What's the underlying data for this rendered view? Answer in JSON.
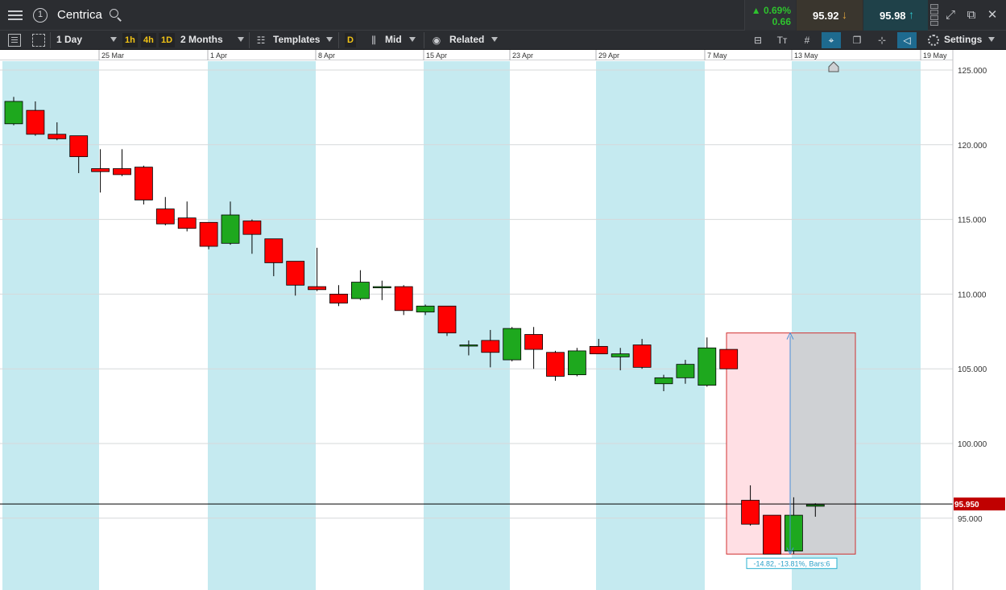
{
  "header": {
    "instrument": "Centrica",
    "change_pct": "0.69%",
    "change_abs": "0.66",
    "sell_price": "95.92",
    "buy_price": "95.98"
  },
  "toolbar": {
    "interval": "1 Day",
    "quick_intervals": [
      "1h",
      "4h",
      "1D"
    ],
    "range": "2 Months",
    "templates": "Templates",
    "d_chip": "D",
    "price_type": "Mid",
    "related": "Related",
    "settings": "Settings",
    "active_tools": [
      "crosshair-tool",
      "label-tool"
    ]
  },
  "colors": {
    "up": "#1ea81e",
    "down": "#ff0000",
    "weekend_band": "#c5eaf0",
    "price_marker": "#c00000",
    "range_box_red": "#ffdfe4",
    "range_box_grey": "#cfd1d4"
  },
  "chart_data": {
    "type": "candlestick",
    "title": "",
    "x_tick_labels": [
      "25 Mar",
      "1 Apr",
      "8 Apr",
      "15 Apr",
      "23 Apr",
      "29 Apr",
      "7 May",
      "13 May",
      "19 May"
    ],
    "y_ticks": [
      95,
      100,
      105,
      110,
      115,
      120,
      125
    ],
    "y_tick_labels": [
      "95.000",
      "100.000",
      "105.000",
      "110.000",
      "115.000",
      "120.000",
      "125.000"
    ],
    "ylim": [
      90.8,
      125.5
    ],
    "grid": true,
    "current_price": 95.95,
    "current_price_label": "95.950",
    "candles": [
      {
        "o": 121.4,
        "h": 123.2,
        "l": 121.3,
        "c": 122.9
      },
      {
        "o": 122.3,
        "h": 122.9,
        "l": 120.6,
        "c": 120.7
      },
      {
        "o": 120.7,
        "h": 121.5,
        "l": 120.3,
        "c": 120.4
      },
      {
        "o": 120.6,
        "h": 120.6,
        "l": 118.1,
        "c": 119.2
      },
      {
        "o": 118.4,
        "h": 119.7,
        "l": 116.8,
        "c": 118.2
      },
      {
        "o": 118.4,
        "h": 119.7,
        "l": 117.9,
        "c": 118.0
      },
      {
        "o": 118.5,
        "h": 118.6,
        "l": 116.0,
        "c": 116.3
      },
      {
        "o": 115.7,
        "h": 116.5,
        "l": 114.6,
        "c": 114.7
      },
      {
        "o": 115.1,
        "h": 116.2,
        "l": 114.2,
        "c": 114.4
      },
      {
        "o": 114.8,
        "h": 114.8,
        "l": 113.0,
        "c": 113.2
      },
      {
        "o": 113.4,
        "h": 116.2,
        "l": 113.3,
        "c": 115.3
      },
      {
        "o": 114.9,
        "h": 115.0,
        "l": 112.7,
        "c": 114.0
      },
      {
        "o": 113.7,
        "h": 113.7,
        "l": 111.2,
        "c": 112.1
      },
      {
        "o": 112.2,
        "h": 112.2,
        "l": 109.9,
        "c": 110.6
      },
      {
        "o": 110.5,
        "h": 113.1,
        "l": 110.2,
        "c": 110.3
      },
      {
        "o": 110.0,
        "h": 110.6,
        "l": 109.2,
        "c": 109.4
      },
      {
        "o": 109.7,
        "h": 111.6,
        "l": 109.6,
        "c": 110.8
      },
      {
        "o": 110.5,
        "h": 110.9,
        "l": 109.6,
        "c": 110.5
      },
      {
        "o": 110.5,
        "h": 110.6,
        "l": 108.6,
        "c": 108.9
      },
      {
        "o": 108.8,
        "h": 109.3,
        "l": 108.6,
        "c": 109.2
      },
      {
        "o": 109.2,
        "h": 109.2,
        "l": 107.2,
        "c": 107.4
      },
      {
        "o": 106.6,
        "h": 106.9,
        "l": 105.9,
        "c": 106.6
      },
      {
        "o": 106.9,
        "h": 107.6,
        "l": 105.1,
        "c": 106.1
      },
      {
        "o": 105.6,
        "h": 107.8,
        "l": 105.5,
        "c": 107.7
      },
      {
        "o": 107.3,
        "h": 107.8,
        "l": 105.0,
        "c": 106.3
      },
      {
        "o": 106.1,
        "h": 106.2,
        "l": 104.2,
        "c": 104.5
      },
      {
        "o": 104.6,
        "h": 106.4,
        "l": 104.5,
        "c": 106.2
      },
      {
        "o": 106.5,
        "h": 107.0,
        "l": 106.0,
        "c": 106.0
      },
      {
        "o": 105.8,
        "h": 106.4,
        "l": 104.9,
        "c": 106.0
      },
      {
        "o": 106.6,
        "h": 107.0,
        "l": 105.0,
        "c": 105.1
      },
      {
        "o": 104.0,
        "h": 104.6,
        "l": 103.5,
        "c": 104.4
      },
      {
        "o": 104.4,
        "h": 105.6,
        "l": 104.0,
        "c": 105.3
      },
      {
        "o": 103.9,
        "h": 107.1,
        "l": 103.8,
        "c": 106.4
      },
      {
        "o": 106.3,
        "h": 106.3,
        "l": 105.0,
        "c": 105.0
      },
      {
        "o": 96.2,
        "h": 97.2,
        "l": 94.5,
        "c": 94.6
      },
      {
        "o": 95.2,
        "h": 95.2,
        "l": 92.6,
        "c": 92.6
      },
      {
        "o": 92.8,
        "h": 96.4,
        "l": 92.6,
        "c": 95.2
      },
      {
        "o": 95.8,
        "h": 96.0,
        "l": 95.1,
        "c": 95.9
      }
    ],
    "range_measure": {
      "label": "-14.82, -13.81%, Bars:6",
      "top": 107.4,
      "bottom": 92.6
    }
  }
}
